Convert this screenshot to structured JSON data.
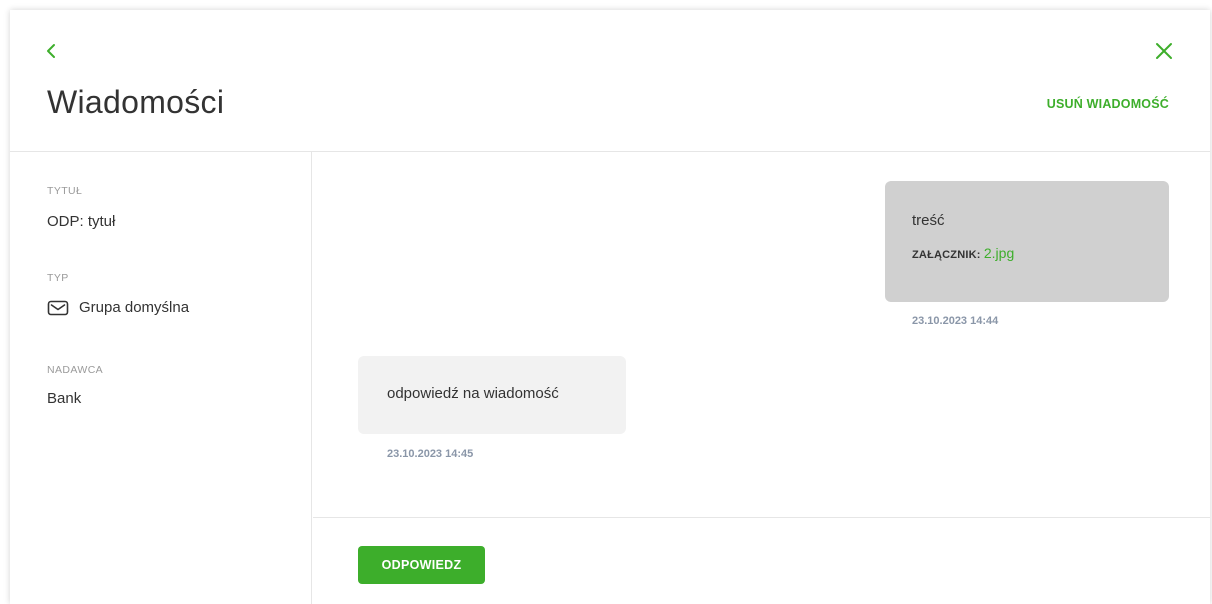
{
  "header": {
    "title": "Wiadomości",
    "delete_label": "USUŃ WIADOMOŚĆ"
  },
  "sidebar": {
    "title_label": "TYTUŁ",
    "title_value": "ODP: tytuł",
    "type_label": "TYP",
    "type_value": "Grupa domyślna",
    "type_icon": "envelope-icon",
    "sender_label": "NADAWCA",
    "sender_value": "Bank"
  },
  "messages": [
    {
      "direction": "outgoing",
      "text": "treść",
      "attachment_label": "ZAŁĄCZNIK:",
      "attachment_name": "2.jpg",
      "timestamp": "23.10.2023 14:44"
    },
    {
      "direction": "incoming",
      "text": "odpowiedź na wiadomość",
      "timestamp": "23.10.2023 14:45"
    }
  ],
  "footer": {
    "reply_label": "ODPOWIEDZ"
  },
  "colors": {
    "accent": "#3dae2b",
    "outgoing_bubble": "#d0d0d0",
    "incoming_bubble": "#f2f2f2",
    "timestamp": "#8a96a8",
    "label": "#9a9a9a",
    "text": "#333333"
  }
}
